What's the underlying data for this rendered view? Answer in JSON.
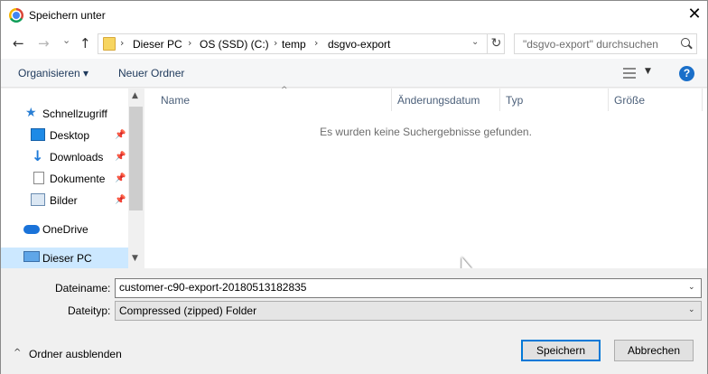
{
  "window": {
    "title": "Speichern unter",
    "close": "✕"
  },
  "nav": {
    "back": "←",
    "forward": "→",
    "recent": "⌄",
    "up": "↑",
    "breadcrumbs": [
      "Dieser PC",
      "OS (SSD) (C:)",
      "temp",
      "dsgvo-export"
    ],
    "separator": "›",
    "refresh": "↻",
    "dropdown": "⌄",
    "search_placeholder": "\"dsgvo-export\" durchsuchen"
  },
  "toolbar": {
    "organize": "Organisieren ▾",
    "new_folder": "Neuer Ordner",
    "help": "?",
    "view_caret": "▼"
  },
  "sidebar": {
    "items": [
      {
        "label": "Schnellzugriff",
        "icon": "star-icon"
      },
      {
        "label": "Desktop",
        "icon": "desktop-icon",
        "pinned": true
      },
      {
        "label": "Downloads",
        "icon": "download-icon",
        "pinned": true
      },
      {
        "label": "Dokumente",
        "icon": "documents-icon",
        "pinned": true
      },
      {
        "label": "Bilder",
        "icon": "pictures-icon",
        "pinned": true
      },
      {
        "label": "OneDrive",
        "icon": "cloud-icon"
      },
      {
        "label": "Dieser PC",
        "icon": "pc-icon",
        "selected": true
      }
    ],
    "pin_glyph": "📌",
    "scroll_up": "▲",
    "scroll_down": "▼"
  },
  "list": {
    "columns": [
      "Name",
      "Änderungsdatum",
      "Typ",
      "Größe"
    ],
    "sort_glyph": "^",
    "empty_message": "Es wurden keine Suchergebnisse gefunden."
  },
  "form": {
    "filename_label": "Dateiname:",
    "filename_value": "customer-c90-export-20180513182835",
    "filetype_label": "Dateityp:",
    "filetype_value": "Compressed (zipped) Folder",
    "dropdown_glyph": "⌄"
  },
  "footer": {
    "hide_folders": "Ordner ausblenden",
    "hide_caret": "^",
    "save": "Speichern",
    "cancel": "Abbrechen"
  }
}
